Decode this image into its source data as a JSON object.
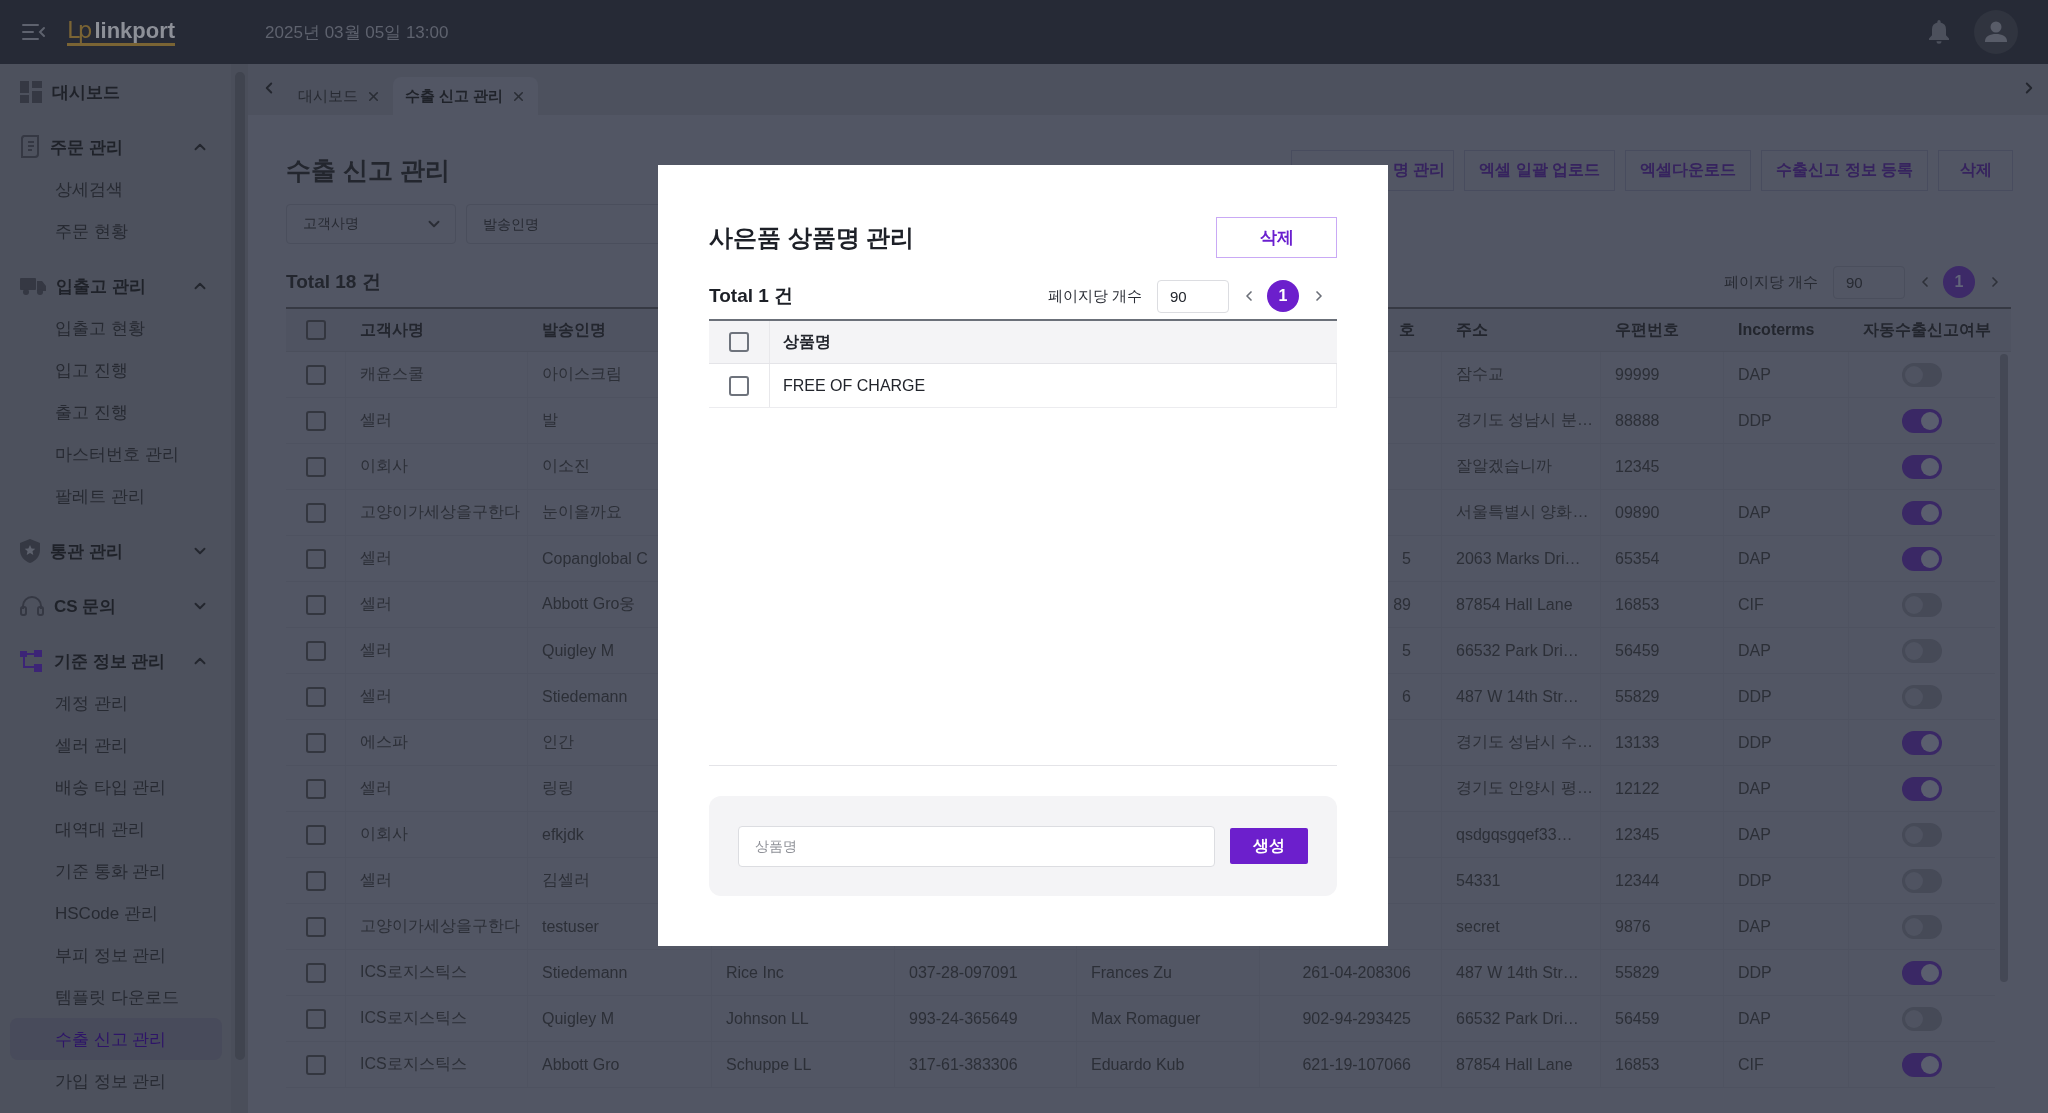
{
  "top_bar": {
    "logo_mark": "Lp",
    "logo_text": "linkport",
    "datetime": "2025년 03월 05일 13:00"
  },
  "sidebar": {
    "items": [
      {
        "kind": "link",
        "label": "대시보드"
      },
      {
        "kind": "group",
        "label": "주문 관리",
        "expanded": true,
        "children": [
          {
            "label": "상세검색",
            "selected": false
          },
          {
            "label": "주문 현황",
            "selected": false
          }
        ]
      },
      {
        "kind": "group",
        "label": "입출고 관리",
        "expanded": true,
        "children": [
          {
            "label": "입출고 현황",
            "selected": false
          },
          {
            "label": "입고 진행",
            "selected": false
          },
          {
            "label": "출고 진행",
            "selected": false
          },
          {
            "label": "마스터번호 관리",
            "selected": false
          },
          {
            "label": "팔레트 관리",
            "selected": false
          }
        ]
      },
      {
        "kind": "group",
        "label": "통관 관리",
        "expanded": false
      },
      {
        "kind": "group",
        "label": "CS 문의",
        "expanded": false
      },
      {
        "kind": "group",
        "label": "기준 정보 관리",
        "expanded": true,
        "children": [
          {
            "label": "계정 관리",
            "selected": false
          },
          {
            "label": "셀러 관리",
            "selected": false
          },
          {
            "label": "배송 타입 관리",
            "selected": false
          },
          {
            "label": "대역대 관리",
            "selected": false
          },
          {
            "label": "기준 통화 관리",
            "selected": false
          },
          {
            "label": "HSCode 관리",
            "selected": false
          },
          {
            "label": "부피 정보 관리",
            "selected": false
          },
          {
            "label": "템플릿 다운로드",
            "selected": false
          },
          {
            "label": "수출 신고 관리",
            "selected": true
          },
          {
            "label": "가입 정보 관리",
            "selected": false
          }
        ]
      }
    ]
  },
  "tabs": [
    {
      "label": "대시보드",
      "selected": false
    },
    {
      "label": "수출 신고 관리",
      "selected": true
    }
  ],
  "page": {
    "title": "수출 신고 관리",
    "toolbar_buttons": [
      "명 관리",
      "엑셀 일괄 업로드",
      "엑셀다운로드",
      "수출신고 정보 등록",
      "삭제"
    ],
    "filters": {
      "customer_select": {
        "placeholder": "고객사명"
      },
      "sender_input": {
        "placeholder": "발송인명"
      }
    },
    "total": "Total 18 건",
    "page_size_label": "페이지당 개수",
    "page_size": "90",
    "pages": [
      {
        "label": "1",
        "selected": true
      }
    ]
  },
  "table": {
    "select_all_checked": false,
    "header": {
      "customer": "고객사명",
      "sender": "발송인명",
      "column_6": "호",
      "address": "주소",
      "postal_code": "우편번호",
      "incoterms": "Incoterms",
      "auto_export": "자동수출신고여부"
    },
    "rows": [
      {
        "checked": false,
        "customer": "캐윤스쿨",
        "sender": "아이스크림",
        "address": "잠수교",
        "postal_code": "99999",
        "incoterms": "DAP",
        "auto_export": false
      },
      {
        "checked": false,
        "customer": "셀러",
        "sender": "발",
        "address": "경기도 성남시 분…",
        "postal_code": "88888",
        "incoterms": "DDP",
        "auto_export": true
      },
      {
        "checked": false,
        "customer": "이회사",
        "sender": "이소진",
        "address": "잘알겠습니까",
        "postal_code": "12345",
        "auto_export": true
      },
      {
        "checked": false,
        "customer": "고양이가세상을구한다",
        "sender": "눈이올까요",
        "address": "서울특별시 양화…",
        "postal_code": "09890",
        "incoterms": "DAP",
        "auto_export": true
      },
      {
        "checked": false,
        "customer": "셀러",
        "sender": "Copanglobal C",
        "column_6": "5",
        "address": "2063 Marks Dri…",
        "postal_code": "65354",
        "incoterms": "DAP",
        "auto_export": true
      },
      {
        "checked": false,
        "customer": "셀러",
        "sender": "Abbott Gro웅",
        "column_6": "89",
        "address": "87854 Hall Lane",
        "postal_code": "16853",
        "incoterms": "CIF",
        "auto_export": false
      },
      {
        "checked": false,
        "customer": "셀러",
        "sender": "Quigley M",
        "column_6": "5",
        "address": "66532 Park Dri…",
        "postal_code": "56459",
        "incoterms": "DAP",
        "auto_export": false
      },
      {
        "checked": false,
        "customer": "셀러",
        "sender": "Stiedemann",
        "column_6": "6",
        "address": "487 W 14th Str…",
        "postal_code": "55829",
        "incoterms": "DDP",
        "auto_export": false
      },
      {
        "checked": false,
        "customer": "에스파",
        "sender": "인간",
        "address": "경기도 성남시 수…",
        "postal_code": "13133",
        "incoterms": "DDP",
        "auto_export": true
      },
      {
        "checked": false,
        "customer": "셀러",
        "sender": "링링",
        "address": "경기도 안양시 평…",
        "postal_code": "12122",
        "incoterms": "DAP",
        "auto_export": true
      },
      {
        "checked": false,
        "customer": "이회사",
        "sender": "efkjdk",
        "address": "qsdgqsgqef33…",
        "postal_code": "12345",
        "incoterms": "DAP",
        "auto_export": false
      },
      {
        "checked": false,
        "customer": "셀러",
        "sender": "김셀러",
        "address": "54331",
        "postal_code": "12344",
        "incoterms": "DDP",
        "auto_export": false
      },
      {
        "checked": false,
        "customer": "고양이가세상을구한다",
        "sender": "testuser",
        "address": "secret",
        "postal_code": "9876",
        "incoterms": "DAP",
        "auto_export": false
      },
      {
        "checked": false,
        "customer": "ICS로지스틱스",
        "sender": "Stiedemann",
        "column_3": "Rice Inc",
        "column_4": "037-28-097091",
        "column_5": "Frances Zu",
        "column_6": "261-04-208306",
        "address": "487 W 14th Str…",
        "postal_code": "55829",
        "incoterms": "DDP",
        "auto_export": true
      },
      {
        "checked": false,
        "customer": "ICS로지스틱스",
        "sender": "Quigley M",
        "column_3": "Johnson LL",
        "column_4": "993-24-365649",
        "column_5": "Max Romaguer",
        "column_6": "902-94-293425",
        "address": "66532 Park Dri…",
        "postal_code": "56459",
        "incoterms": "DAP",
        "auto_export": false
      },
      {
        "checked": false,
        "customer": "ICS로지스틱스",
        "sender": "Abbott Gro",
        "column_3": "Schuppe LL",
        "column_4": "317-61-383306",
        "column_5": "Eduardo Kub",
        "column_6": "621-19-107066",
        "address": "87854 Hall Lane",
        "postal_code": "16853",
        "incoterms": "CIF",
        "auto_export": true
      }
    ]
  },
  "modal": {
    "title": "사은품 상품명 관리",
    "delete_button": "삭제",
    "total": "Total 1 건",
    "page_size_label": "페이지당 개수",
    "page_size": "90",
    "pages": [
      {
        "label": "1",
        "selected": true
      }
    ],
    "table": {
      "select_all_checked": false,
      "column": "상품명",
      "rows": [
        {
          "name": "FREE OF CHARGE",
          "checked": false
        }
      ]
    },
    "create_form": {
      "placeholder": "상품명",
      "button": "생성"
    }
  }
}
